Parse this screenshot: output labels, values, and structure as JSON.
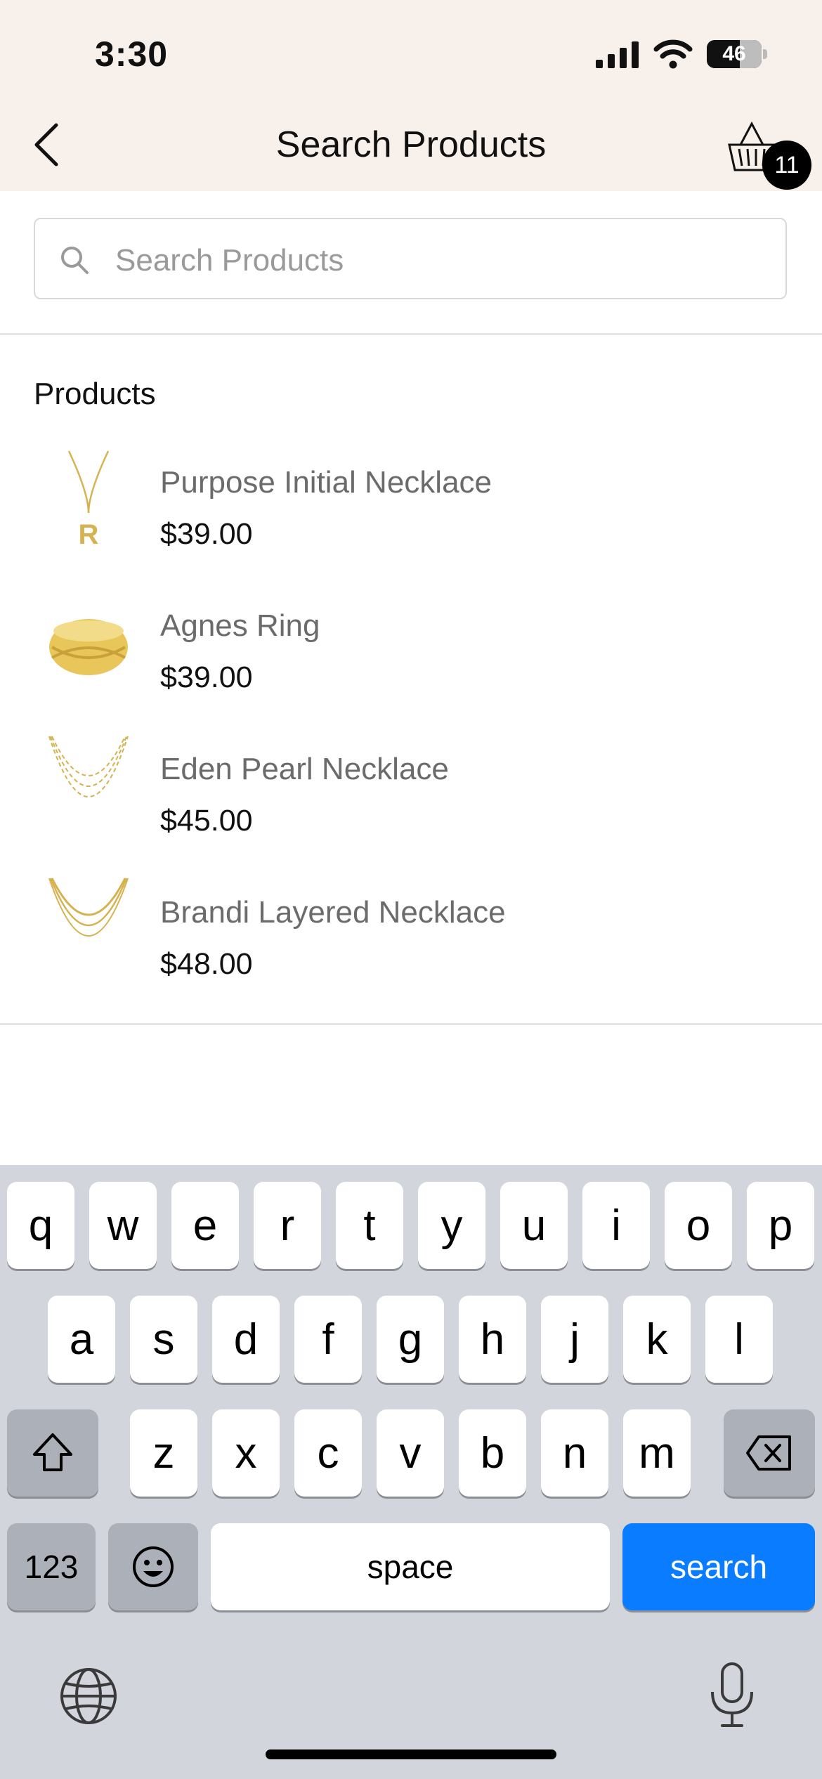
{
  "status_bar": {
    "time": "3:30",
    "battery": "46"
  },
  "header": {
    "title": "Search Products",
    "cart_count": "11"
  },
  "search": {
    "placeholder": "Search Products",
    "value": ""
  },
  "section_title": "Products",
  "products": [
    {
      "name": "Purpose Initial Necklace",
      "price": "$39.00"
    },
    {
      "name": "Agnes Ring",
      "price": "$39.00"
    },
    {
      "name": "Eden Pearl Necklace",
      "price": "$45.00"
    },
    {
      "name": "Brandi Layered Necklace",
      "price": "$48.00"
    }
  ],
  "keyboard": {
    "row1": [
      "q",
      "w",
      "e",
      "r",
      "t",
      "y",
      "u",
      "i",
      "o",
      "p"
    ],
    "row2": [
      "a",
      "s",
      "d",
      "f",
      "g",
      "h",
      "j",
      "k",
      "l"
    ],
    "row3": [
      "z",
      "x",
      "c",
      "v",
      "b",
      "n",
      "m"
    ],
    "numbers_label": "123",
    "space_label": "space",
    "search_label": "search"
  },
  "colors": {
    "header_bg": "#f8f0eb",
    "accent": "#0a7cff",
    "keyboard_bg": "#d3d5dc"
  }
}
